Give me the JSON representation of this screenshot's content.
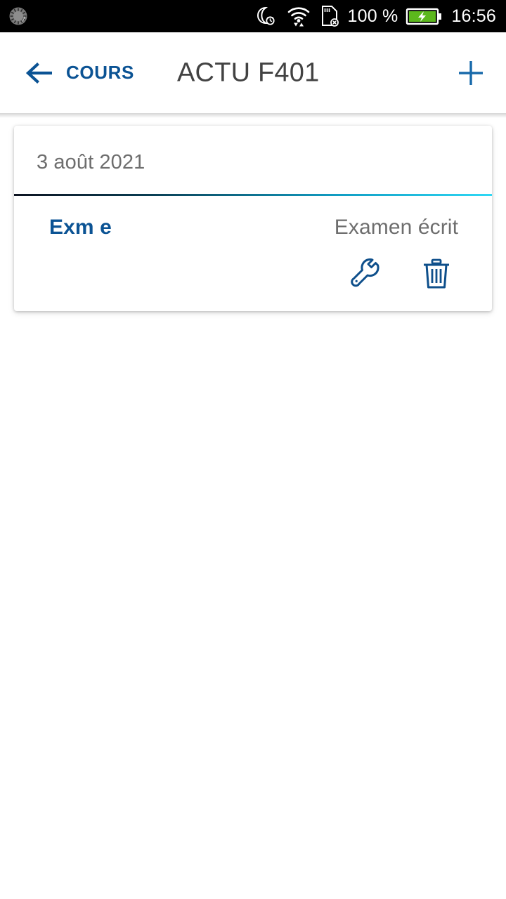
{
  "status_bar": {
    "left_icon": "sync-dial-icon",
    "icons": [
      "moon-alarm-icon",
      "wifi-icon",
      "sd-card-missing-icon"
    ],
    "battery_percent": "100 %",
    "battery_icon": "battery-charging-icon",
    "time": "16:56",
    "background_color": "#000000",
    "text_color": "#ffffff",
    "battery_fill_color": "#5cb81d"
  },
  "app_bar": {
    "back_label": "COURS",
    "back_icon": "arrow-left-icon",
    "title": "ACTU F401",
    "add_icon": "plus-icon",
    "accent_color": "#0b5394",
    "title_color": "#424242"
  },
  "card": {
    "date": "3 août 2021",
    "divider_gradient_from": "#0d1321",
    "divider_gradient_to": "#2fd8f5",
    "row": {
      "name": "Exm e",
      "type": "Examen écrit",
      "edit_icon": "wrench-icon",
      "delete_icon": "trash-icon",
      "name_color": "#0b5394",
      "type_color": "#6e6e6e",
      "icon_color": "#0e4f8b"
    }
  }
}
